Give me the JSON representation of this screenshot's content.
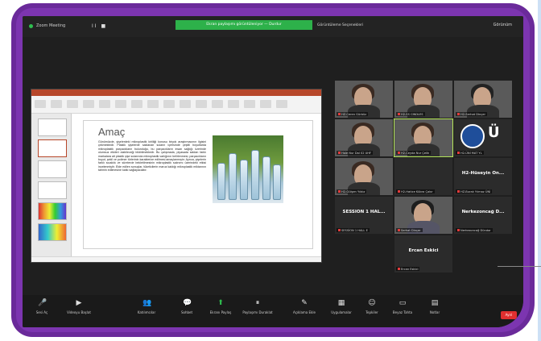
{
  "topbar": {
    "meeting_name": "Zoom Meeting",
    "controls": "II ■",
    "share_banner": "Ekran paylaşımı görüntüleniyor — Durdur",
    "view_options": "Görüntüleme Seçenekleri",
    "view_button": "Görünüm"
  },
  "slide": {
    "title": "Amaç",
    "body": "Günümüzde, şişelerdeki mikroplastik kirliliği konusu birçok araştırmacının ilgisini çekmektedir. Plastik şişelerde saklanan suların içerisinde çeşitli boyutlarda mikroplastik parçacıkların bulunduğu, bu parçacıkların insan sağlığı üzerinde olumsuz etkileri olabileceği bildirilmektedir. Bu çalışmada, piyasada satılan farklı markalara ait plastik şişe sularında mikroplastik varlığının belirlenmesi, parçacıkların boyut, şekil ve polimer türlerinin karakterize edilmesi amaçlanmıştır. Ayrıca, şişelerin farklı sıcaklık ve sürelerde bekletilmesinin mikroplastik salınımı üzerindeki etkisi incelenmiştir. Elde edilen sonuçlar, tüketicilerin maruz kaldığı mikroplastik miktarının tahmin edilmesine katkı sağlayacaktır."
  },
  "participants": [
    {
      "label": "HZ-Ceren Gürbüz",
      "kind": "video"
    },
    {
      "label": "H2-SS CINDLES",
      "kind": "video"
    },
    {
      "label": "H2-Serhat Dinçer",
      "kind": "video"
    },
    {
      "label": "Hale Nur Dal 02 UHF",
      "kind": "video"
    },
    {
      "label": "H2-Ceyda Nur Çelik",
      "kind": "video"
    },
    {
      "label": "H2-ÜNİ MAT YL",
      "kind": "logo"
    },
    {
      "label": "H2-Gülşen Yıldız",
      "kind": "video"
    },
    {
      "label": "H2-Hatice Kübra Çakır",
      "kind": "dark"
    },
    {
      "label": "HZ-Burak Yılmaz ÜNİ",
      "kind": "name",
      "name": "H2-Hüseyin On..."
    },
    {
      "label": "SESSİON 1 HALL E",
      "kind": "name",
      "name": "SESSİON 1 HAL..."
    },
    {
      "label": "Serhat Dinçer",
      "kind": "video"
    },
    {
      "label": "Nerkezoncağ Dündar",
      "kind": "name",
      "name": "Nerkezoncağ D..."
    },
    {
      "label": "Ercan Eskici",
      "kind": "name",
      "name": "Ercan Eskici"
    }
  ],
  "toolbar": {
    "items": [
      {
        "icon": "microphone-icon",
        "glyph": "🎤",
        "label": "Sesi Aç"
      },
      {
        "icon": "video-icon",
        "glyph": "▶",
        "label": "Videoyu Başlat"
      },
      {
        "icon": "participants-icon",
        "glyph": "👥",
        "label": "Katılımcılar"
      },
      {
        "icon": "chat-icon",
        "glyph": "💬",
        "label": "Sohbet"
      },
      {
        "icon": "share-screen-icon",
        "glyph": "⬆",
        "label": "Ekranı Paylaş"
      },
      {
        "icon": "pause-share-icon",
        "glyph": "⏸",
        "label": "Paylaşımı Duraklat"
      },
      {
        "icon": "annotate-icon",
        "glyph": "✎",
        "label": "Açıklama Ekle"
      },
      {
        "icon": "apps-icon",
        "glyph": "▦",
        "label": "Uygulamalar"
      },
      {
        "icon": "reactions-icon",
        "glyph": "☺",
        "label": "Tepkiler"
      },
      {
        "icon": "whiteboard-icon",
        "glyph": "▭",
        "label": "Beyaz Tahta"
      },
      {
        "icon": "notes-icon",
        "glyph": "▤",
        "label": "Notlar"
      }
    ],
    "end_label": "Ayrıl"
  },
  "colors": {
    "frame": "#7c35b0",
    "zoom_bg": "#1f1f1f",
    "share_banner": "#2db14a",
    "ppt_accent": "#b7472a",
    "active_speaker": "#b6e85a"
  }
}
